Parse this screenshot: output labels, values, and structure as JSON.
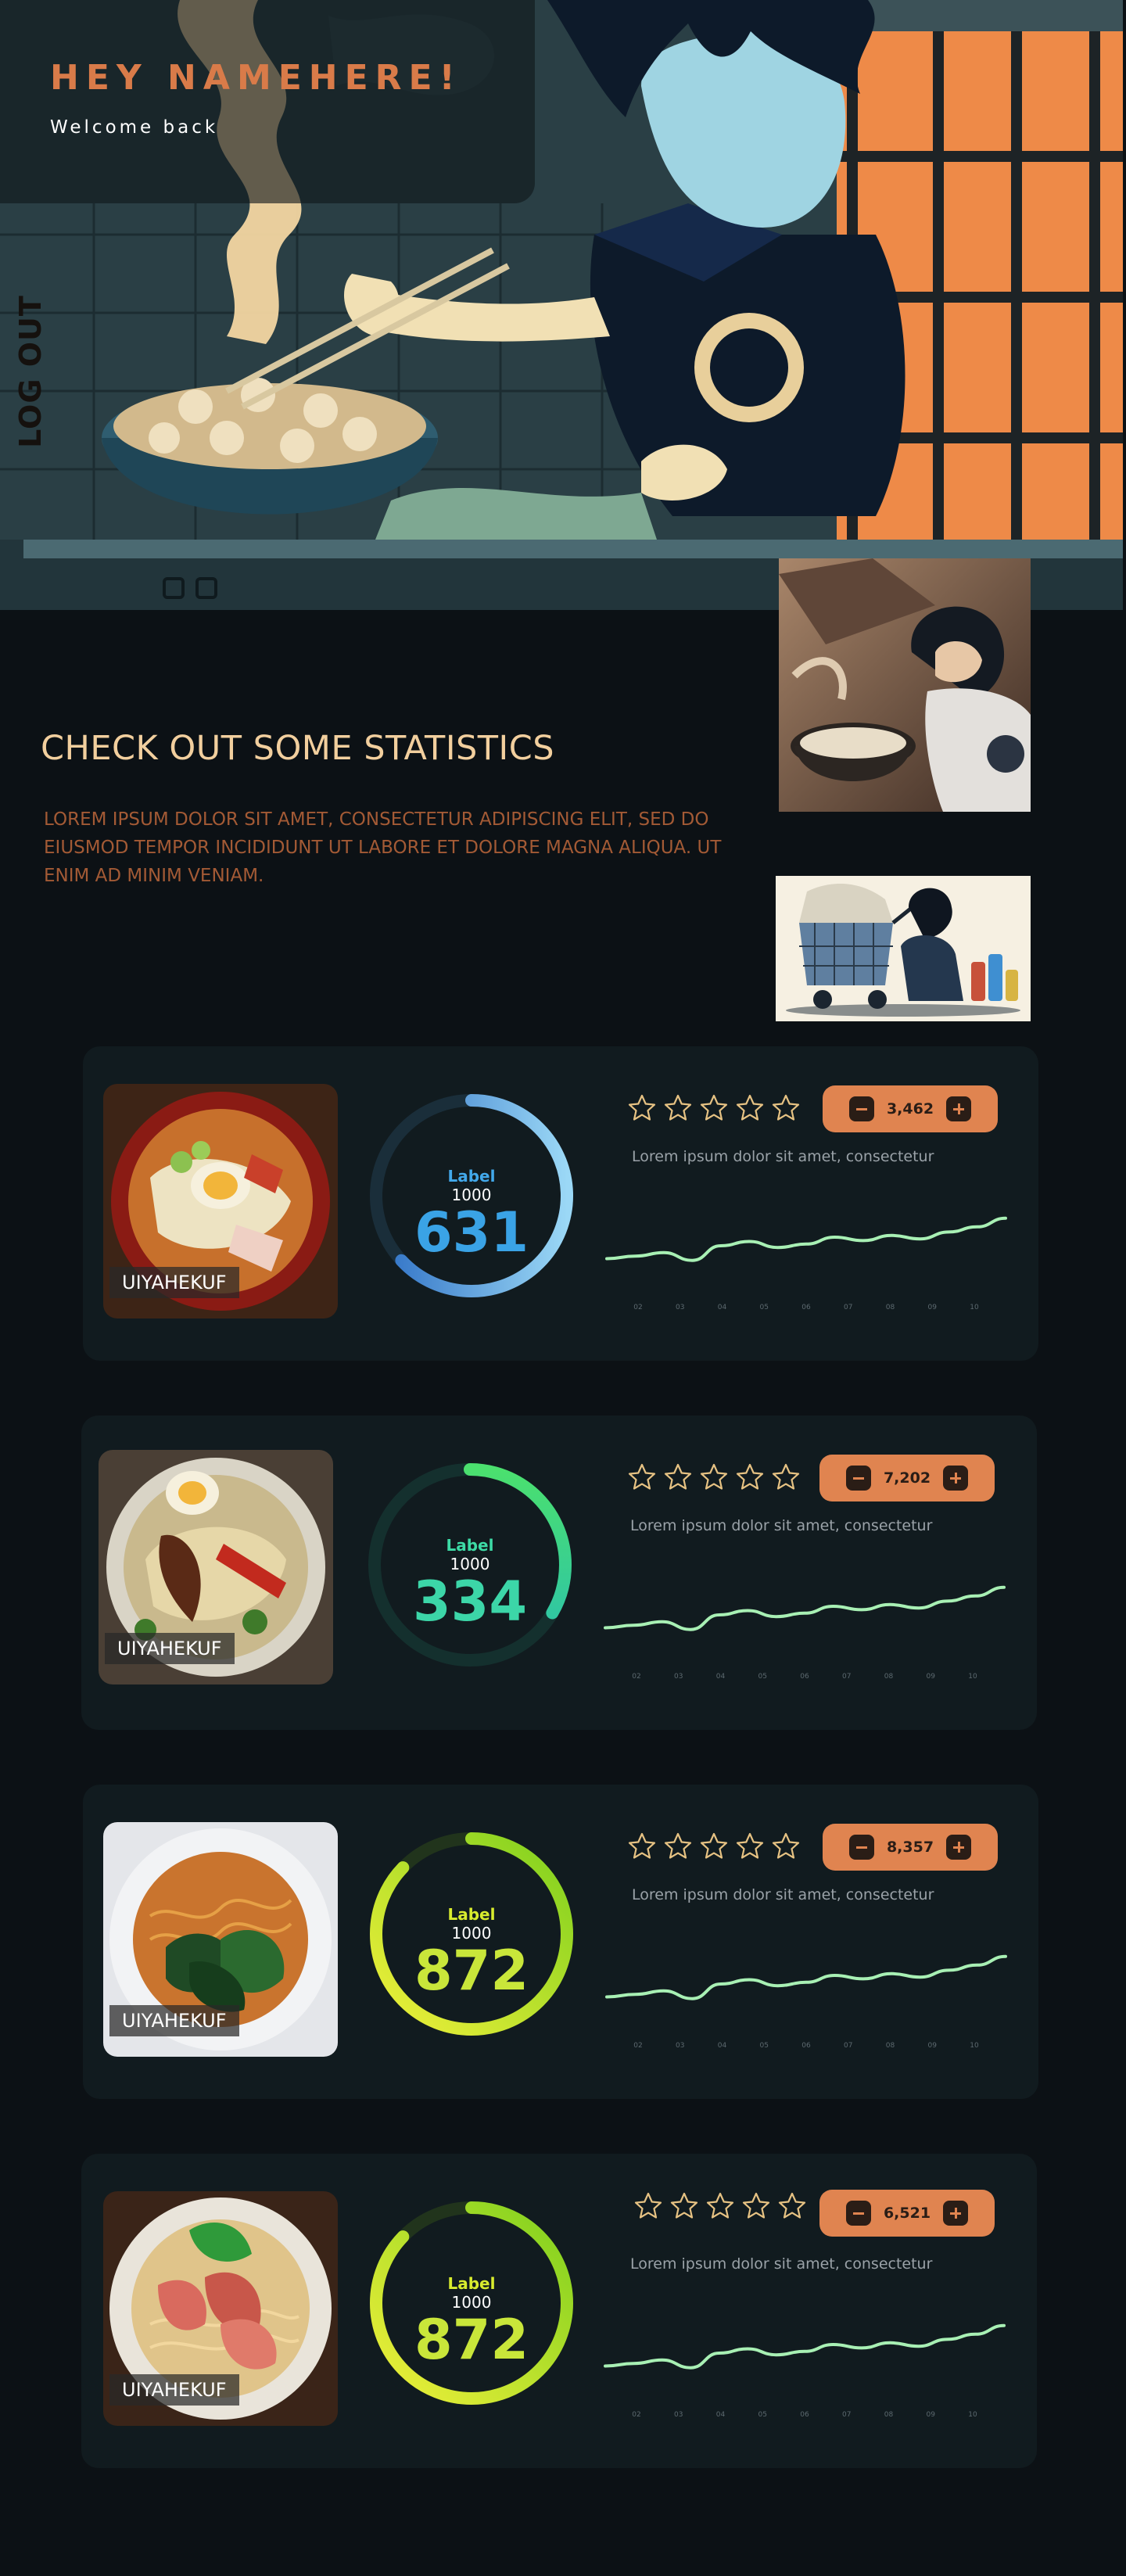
{
  "header": {
    "greeting": "HEY NAMEHERE!",
    "subtitle": "Welcome back",
    "logout_label": "LOG OUT"
  },
  "images": {
    "hero": "anime-character-cooking-ramen-illustration",
    "side_top": "anime-character-stirring-pot-photo",
    "side_bottom": "anime-character-with-shopping-cart-illustration"
  },
  "stats": {
    "title": "CHECK OUT SOME STATISTICS",
    "description": "LOREM IPSUM DOLOR SIT AMET, CONSECTETUR ADIPISCING ELIT, SED DO EIUSMOD TEMPOR INCIDIDUNT UT LABORE ET DOLORE MAGNA ALIQUA. UT ENIM AD MINIM VENIAM."
  },
  "colors": {
    "accent": "#e08450",
    "heading": "#f2cf9e",
    "description": "#a35a35",
    "card_bg": "#111b1f",
    "star": "#e6c283",
    "sparkline": "#a8f0b4"
  },
  "cards": [
    {
      "image": "ramen-bowl-egg-pork",
      "image_label": "UIYAHEKUF",
      "gauge": {
        "label": "Label",
        "total": "1000",
        "value": "631",
        "progress": 0.631,
        "colors": [
          "#2d6fc4",
          "#9bd8f6"
        ],
        "label_color": "#42a8ea",
        "value_color": "#3aa3e6"
      },
      "rating": {
        "stars": 5,
        "filled": 0
      },
      "counter": {
        "value": "3,462"
      },
      "description": "Lorem ipsum dolor sit amet, consectetur",
      "x_ticks": [
        "02",
        "03",
        "04",
        "05",
        "06",
        "07",
        "08",
        "09",
        "10"
      ],
      "sparkline": [
        0.35,
        0.38,
        0.42,
        0.33,
        0.5,
        0.55,
        0.48,
        0.52,
        0.6,
        0.56,
        0.62,
        0.58,
        0.66,
        0.72,
        0.82
      ]
    },
    {
      "image": "ramen-bowl-noodles-greens",
      "image_label": "UIYAHEKUF",
      "gauge": {
        "label": "Label",
        "total": "1000",
        "value": "334",
        "progress": 0.334,
        "colors": [
          "#29c0b0",
          "#4be06e"
        ],
        "label_color": "#3ddba6",
        "value_color": "#3cd6a8"
      },
      "rating": {
        "stars": 5,
        "filled": 0
      },
      "counter": {
        "value": "7,202"
      },
      "description": "Lorem ipsum dolor sit amet, consectetur",
      "x_ticks": [
        "02",
        "03",
        "04",
        "05",
        "06",
        "07",
        "08",
        "09",
        "10"
      ],
      "sparkline": [
        0.35,
        0.38,
        0.42,
        0.33,
        0.5,
        0.55,
        0.48,
        0.52,
        0.6,
        0.56,
        0.62,
        0.58,
        0.66,
        0.72,
        0.82
      ]
    },
    {
      "image": "instant-noodles-spinach-bowl",
      "image_label": "UIYAHEKUF",
      "gauge": {
        "label": "Label",
        "total": "1000",
        "value": "872",
        "progress": 0.872,
        "colors": [
          "#f0f03a",
          "#7ed01e"
        ],
        "label_color": "#d8ec2e",
        "value_color": "#c9e63a"
      },
      "rating": {
        "stars": 5,
        "filled": 0
      },
      "counter": {
        "value": "8,357"
      },
      "description": "Lorem ipsum dolor sit amet, consectetur",
      "x_ticks": [
        "02",
        "03",
        "04",
        "05",
        "06",
        "07",
        "08",
        "09",
        "10"
      ],
      "sparkline": [
        0.35,
        0.38,
        0.42,
        0.33,
        0.5,
        0.55,
        0.48,
        0.52,
        0.6,
        0.56,
        0.62,
        0.58,
        0.66,
        0.72,
        0.82
      ]
    },
    {
      "image": "ramen-bowl-char-siu",
      "image_label": "UIYAHEKUF",
      "gauge": {
        "label": "Label",
        "total": "1000",
        "value": "872",
        "progress": 0.872,
        "colors": [
          "#f0f03a",
          "#7ed01e"
        ],
        "label_color": "#d8ec2e",
        "value_color": "#c9e63a"
      },
      "rating": {
        "stars": 5,
        "filled": 0
      },
      "counter": {
        "value": "6,521"
      },
      "description": "Lorem ipsum dolor sit amet, consectetur",
      "x_ticks": [
        "02",
        "03",
        "04",
        "05",
        "06",
        "07",
        "08",
        "09",
        "10"
      ],
      "sparkline": [
        0.35,
        0.38,
        0.42,
        0.33,
        0.5,
        0.55,
        0.48,
        0.52,
        0.6,
        0.56,
        0.62,
        0.58,
        0.66,
        0.72,
        0.82
      ]
    }
  ]
}
